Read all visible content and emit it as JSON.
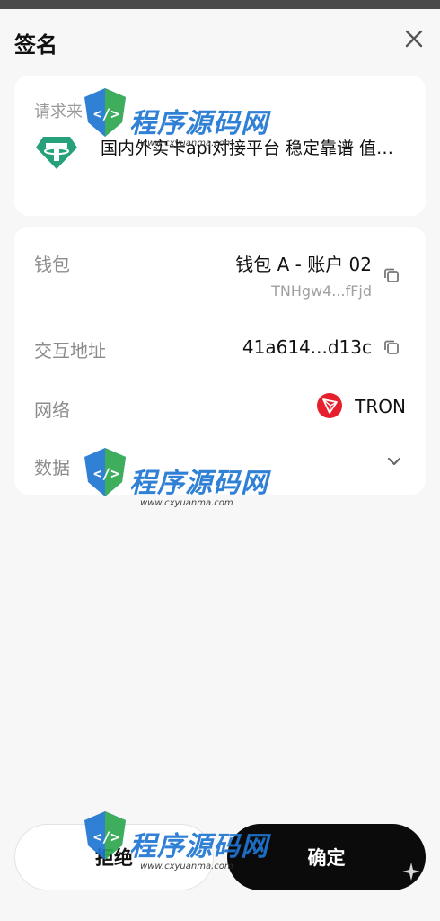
{
  "header": {
    "title": "签名"
  },
  "request": {
    "label": "请求来",
    "app_name": "国内外实卡api对接平台 稳定靠谱 值…",
    "app_icon": "tether-usdt-icon"
  },
  "details": {
    "wallet": {
      "label": "钱包",
      "name": "钱包 A - 账户 02",
      "address": "TNHgw4...fFjd"
    },
    "contract": {
      "label": "交互地址",
      "address": "41a614...d13c"
    },
    "network": {
      "label": "网络",
      "name": "TRON",
      "icon": "tron-icon"
    },
    "data": {
      "label": "数据"
    }
  },
  "actions": {
    "reject_label": "拒绝",
    "confirm_label": "确定"
  },
  "watermark": {
    "text": "程序源码网",
    "url": "www.cxyuanma.com"
  },
  "colors": {
    "tether_green": "#26a17b",
    "tron_red": "#e5202c",
    "confirm_bg": "#0b0b0b",
    "watermark_blue": "#1f76d3"
  }
}
